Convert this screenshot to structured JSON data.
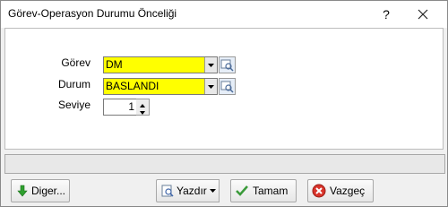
{
  "window": {
    "title": "Görev-Operasyon Durumu Önceliği",
    "help_label": "?"
  },
  "form": {
    "gorev": {
      "label": "Görev",
      "value": "DM"
    },
    "durum": {
      "label": "Durum",
      "value": "BASLANDI"
    },
    "seviye": {
      "label": "Seviye",
      "value": "1"
    }
  },
  "colors": {
    "field_highlight": "#ffff00"
  },
  "buttons": {
    "diger": {
      "label": "Diger...",
      "icon": "green-down-arrow-icon"
    },
    "yazdir": {
      "label": "Yazdır",
      "icon": "print-preview-icon"
    },
    "tamam": {
      "label": "Tamam",
      "icon": "checkmark-icon"
    },
    "vazgec": {
      "label": "Vazgeç",
      "icon": "red-x-icon"
    }
  }
}
